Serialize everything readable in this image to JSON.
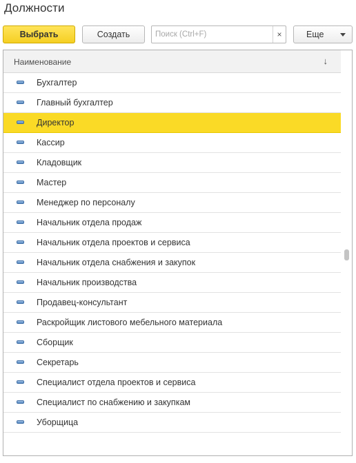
{
  "window": {
    "title": "Должности"
  },
  "toolbar": {
    "select_label": "Выбрать",
    "create_label": "Создать",
    "search_placeholder": "Поиск (Ctrl+F)",
    "search_value": "",
    "clear_symbol": "×",
    "more_label": "Еще",
    "more_icon": "chevron-down-icon"
  },
  "grid": {
    "column_header": "Наименование",
    "sort_indicator": "↓",
    "row_icon": "position-item-icon",
    "selected_index": 2,
    "items": [
      {
        "label": "Бухгалтер"
      },
      {
        "label": "Главный бухгалтер"
      },
      {
        "label": "Директор"
      },
      {
        "label": "Кассир"
      },
      {
        "label": "Кладовщик"
      },
      {
        "label": "Мастер"
      },
      {
        "label": "Менеджер по персоналу"
      },
      {
        "label": "Начальник отдела продаж"
      },
      {
        "label": "Начальник отдела проектов и сервиса"
      },
      {
        "label": "Начальник отдела снабжения и закупок"
      },
      {
        "label": "Начальник производства"
      },
      {
        "label": "Продавец-консультант"
      },
      {
        "label": "Раскройщик листового мебельного материала"
      },
      {
        "label": "Сборщик"
      },
      {
        "label": "Секретарь"
      },
      {
        "label": "Специалист отдела проектов и сервиса"
      },
      {
        "label": "Специалист по снабжению и закупкам"
      },
      {
        "label": "Уборщица"
      }
    ]
  },
  "colors": {
    "accent_selected_row": "#fada26",
    "select_button": "#f5cf23",
    "row_icon": "#4f84c0"
  }
}
